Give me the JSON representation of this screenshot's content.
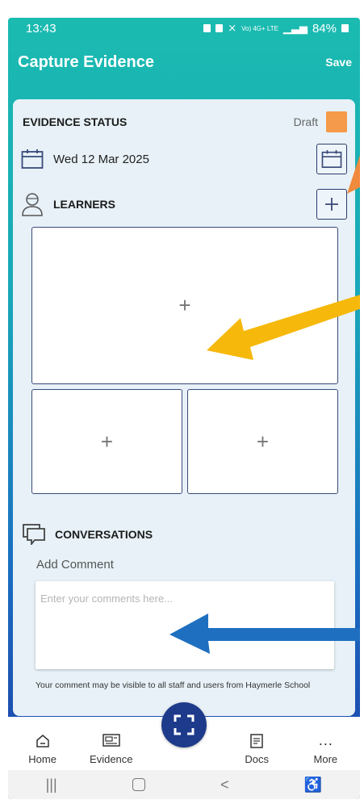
{
  "status_bar": {
    "time": "13:43",
    "network_text": "Vo) 4G+ LTE",
    "battery": "84%"
  },
  "app_bar": {
    "title": "Capture Evidence",
    "save_label": "Save"
  },
  "evidence": {
    "status_label": "EVIDENCE STATUS",
    "status_value": "Draft",
    "status_color": "#f59a4a",
    "date": "Wed 12 Mar 2025",
    "learners_label": "LEARNERS",
    "photo_add_glyph": "+"
  },
  "conversations": {
    "label": "CONVERSATIONS",
    "add_comment_label": "Add Comment",
    "comment_placeholder": "Enter your comments here...",
    "disclaimer": "Your comment may be visible to all staff and users from Haymerle School"
  },
  "bottom_nav": {
    "items": [
      {
        "label": "Home",
        "icon": "home-icon"
      },
      {
        "label": "Evidence",
        "icon": "evidence-icon"
      },
      {
        "label": "",
        "icon": "scan-icon"
      },
      {
        "label": "Docs",
        "icon": "docs-icon"
      },
      {
        "label": "More",
        "icon": "more-icon"
      }
    ]
  },
  "colors": {
    "accent": "#1bbbb0",
    "nav_button": "#1e3a8a",
    "arrow_yellow": "#f6b80b",
    "arrow_blue": "#1f6fc0",
    "arrow_orange": "#f08a3c"
  }
}
